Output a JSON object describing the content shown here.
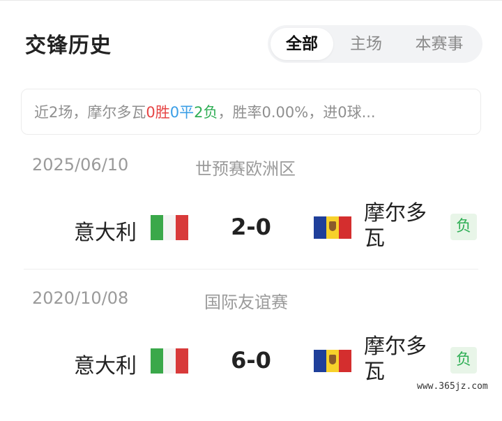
{
  "header": {
    "title": "交锋历史",
    "tabs": [
      {
        "label": "全部",
        "active": true
      },
      {
        "label": "主场",
        "active": false
      },
      {
        "label": "本赛事",
        "active": false
      }
    ]
  },
  "summary": {
    "prefix": "近2场，摩尔多瓦",
    "wins_value": "0",
    "wins_label": "胜",
    "draws_value": "0",
    "draws_label": "平",
    "losses_value": "2",
    "losses_label": "负",
    "suffix": "，胜率0.00%，进0球..."
  },
  "colors": {
    "win": "#e64545",
    "draw": "#3a9ee6",
    "loss": "#2fae55"
  },
  "matches": [
    {
      "date": "2025/06/10",
      "league": "世预赛欧洲区",
      "home": "意大利",
      "score": "2-0",
      "away": "摩尔多瓦",
      "result": "负",
      "home_flag": "italy-flag",
      "away_flag": "moldova-flag"
    },
    {
      "date": "2020/10/08",
      "league": "国际友谊赛",
      "home": "意大利",
      "score": "6-0",
      "away": "摩尔多瓦",
      "result": "负",
      "home_flag": "italy-flag",
      "away_flag": "moldova-flag"
    }
  ],
  "watermark": "www.365jz.com"
}
